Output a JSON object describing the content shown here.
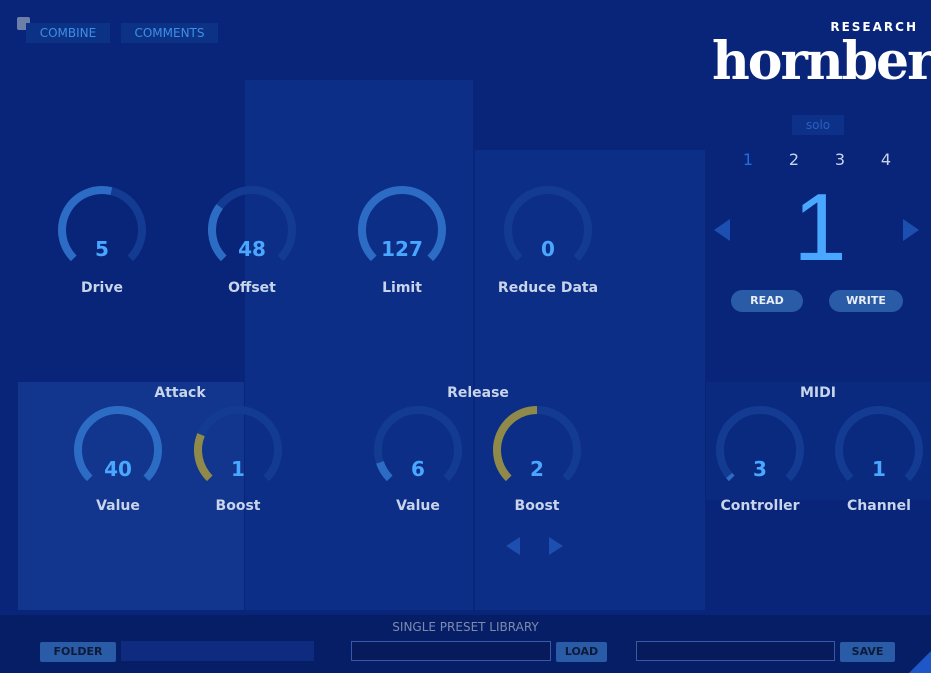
{
  "top_buttons": {
    "combine": "COMBINE",
    "comments": "COMMENTS"
  },
  "logo": {
    "word": "hornberg",
    "research": "RESEARCH"
  },
  "knobs": {
    "drive": {
      "value": "5",
      "label": "Drive",
      "level": 0.55
    },
    "offset": {
      "value": "48",
      "label": "Offset",
      "level": 0.3
    },
    "limit": {
      "value": "127",
      "label": "Limit",
      "level": 1.0
    },
    "reduce": {
      "value": "0",
      "label": "Reduce Data",
      "level": 0.0
    },
    "attack_value": {
      "value": "40",
      "label": "Value",
      "level": 1.0
    },
    "attack_boost": {
      "value": "1",
      "label": "Boost",
      "level": 0.25
    },
    "release_value": {
      "value": "6",
      "label": "Value",
      "level": 0.1
    },
    "release_boost": {
      "value": "2",
      "label": "Boost",
      "level": 0.5
    },
    "midi_controller": {
      "value": "3",
      "label": "Controller",
      "level": 0.02
    },
    "midi_channel": {
      "value": "1",
      "label": "Channel",
      "level": 0.0
    }
  },
  "sections": {
    "attack": "Attack",
    "release": "Release",
    "midi": "MIDI"
  },
  "preset": {
    "solo": "solo",
    "slots": [
      "1",
      "2",
      "3",
      "4"
    ],
    "active_slot": "1",
    "current": "1",
    "read": "READ",
    "write": "WRITE"
  },
  "library": {
    "title": "SINGLE PRESET LIBRARY",
    "folder": "FOLDER",
    "load": "LOAD",
    "save": "SAVE"
  },
  "colors": {
    "background": "#08257a",
    "accent_blue": "#4aa7ff",
    "arc_blue": "#2d6cc4",
    "arc_olive": "#8f8a4a",
    "arc_track": "#143b92"
  }
}
